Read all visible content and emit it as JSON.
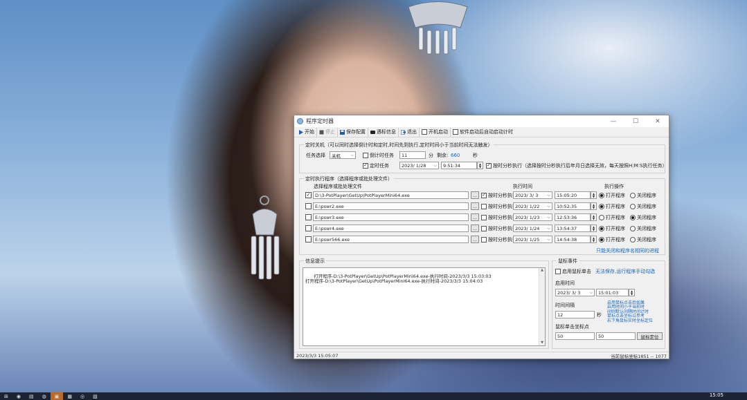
{
  "window": {
    "title": "程序定时器"
  },
  "toolbar": {
    "start": "开始",
    "stop": "停止",
    "save": "保存配置",
    "mouse_info": "遇标信息",
    "exit": "退出",
    "autostart": "开机启动",
    "auto_run": "软件启动后自动启动计时"
  },
  "shutdown": {
    "group_title": "定时关机（可以同时选择倒计时和定时,时间先到执行,定时时间小于当前时间无法触发）",
    "task_label": "任务选择",
    "task_value": "关机",
    "countdown_label": "倒计时任务",
    "countdown_checked": false,
    "countdown_value": "11",
    "minutes_unit": "分",
    "remaining_label": "剩余:",
    "remaining_value": "660",
    "seconds_unit": "秒",
    "timed_label": "定时任务",
    "timed_checked": true,
    "date_value": "2023/ 1/28",
    "time_value": "9:51:34",
    "daily_checked": true,
    "daily_label": "按时分秒执行（选择按时分秒执行后年月日选择无效，每天按照H:M:S执行任务）"
  },
  "programs": {
    "group_title": "定时执行程序（选择程序或批处理文件）",
    "col_program": "选择程序或批处理文件",
    "col_time": "执行时间",
    "col_action": "执行操作",
    "browse_label": "...",
    "daily_label": "按时分秒执行",
    "open_label": "打开程序",
    "close_label": "关闭程序",
    "rows": [
      {
        "checked": true,
        "path": "D:\\3-PotPlayer\\GetUp\\PotPlayerMini64.exe",
        "daily": true,
        "date": "2023/ 3/ 3",
        "time": "15:05:20",
        "action": "open"
      },
      {
        "checked": false,
        "path": "E:\\pswr2.exe",
        "daily": false,
        "date": "2023/ 1/22",
        "time": "10:52:35",
        "action": "open"
      },
      {
        "checked": false,
        "path": "E:\\pswr3.exe",
        "daily": false,
        "date": "2023/ 1/23",
        "time": "12:53:36",
        "action": "close"
      },
      {
        "checked": false,
        "path": "E:\\pswr4.exe",
        "daily": false,
        "date": "2023/ 1/24",
        "time": "13:54:37",
        "action": "open"
      },
      {
        "checked": false,
        "path": "E:\\pswr566.exe",
        "daily": false,
        "date": "2023/ 1/25",
        "time": "14:54:38",
        "action": "open"
      }
    ],
    "note": "只能关闭和程序名相同的进程"
  },
  "info": {
    "group_title": "信息提示",
    "log": "打开程序-D:\\3-PotPlayer\\GetUp\\PotPlayerMini64.exe-执行时间-2023/3/3 15:03:03\n打开程序-D:\\3-PotPlayer\\GetUp\\PotPlayerMini64.exe-执行时间-2023/3/3 15:04:03"
  },
  "mouse": {
    "group_title": "鼠标事件",
    "enable_label": "启用鼠标单击",
    "enable_checked": false,
    "enable_hint": "无法保存,运行程序手动勾选",
    "start_time_label": "启用时间",
    "start_date": "2023/ 3/ 3",
    "start_time": "15:01:03",
    "interval_label": "时间间隔",
    "interval_value": "12",
    "seconds_unit": "秒",
    "hint": "启用鼠标点击后如果\n启用时间小于当前时\n间则默认间隔时间计时\n鼠标点击坐标以参考\n右下角鼠标实时坐标定位",
    "coord_label": "鼠标单击坐标点",
    "x": "50",
    "y": "50",
    "locate_button": "鼠标定位"
  },
  "statusbar": {
    "datetime": "2023/3/3 15:05:07",
    "mouse_coords": "当前鼠标坐标1851 -- 1077"
  },
  "taskbar": {
    "clock_time": "15:05"
  }
}
